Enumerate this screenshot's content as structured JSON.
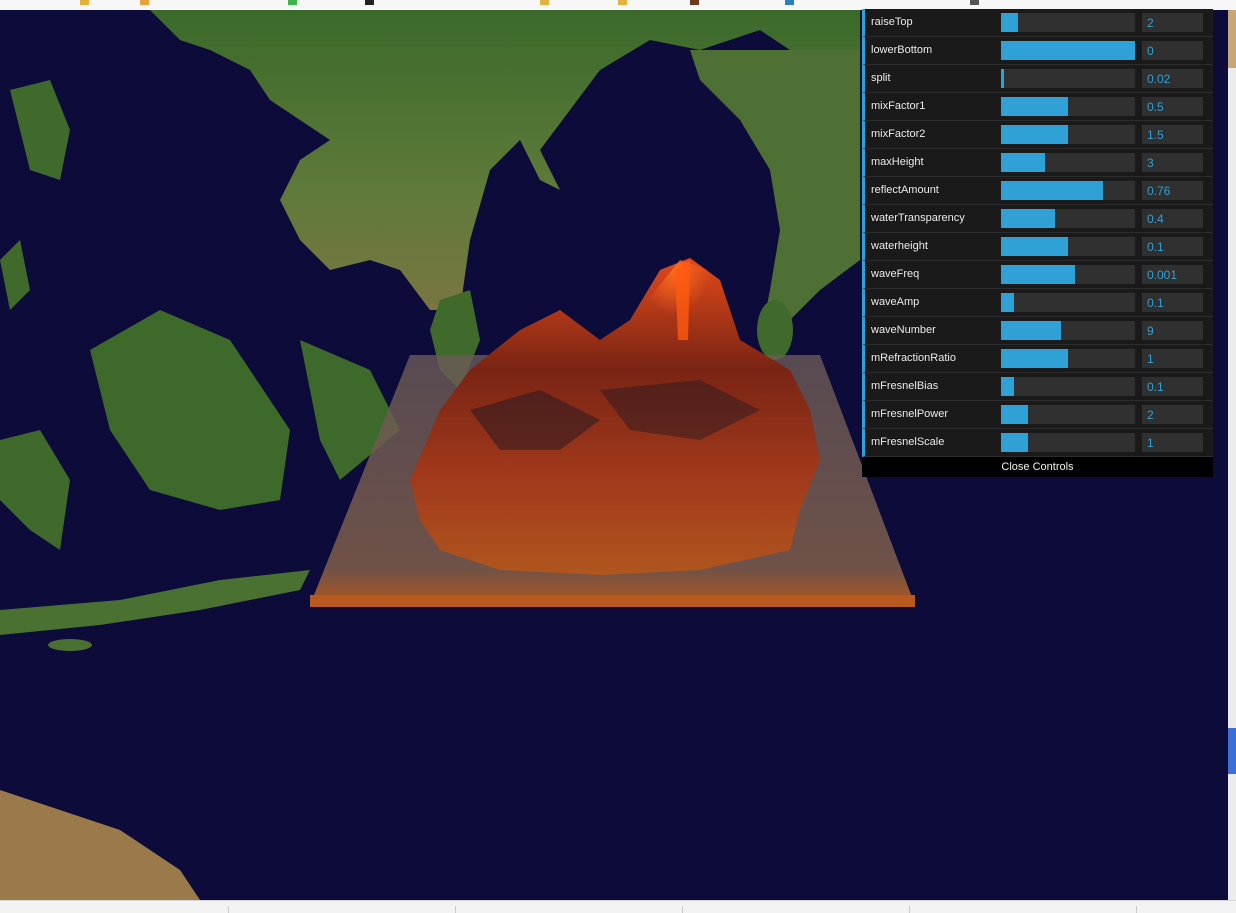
{
  "gui": {
    "controls": [
      {
        "label": "raiseTop",
        "value": "2",
        "fill": 0.13
      },
      {
        "label": "lowerBottom",
        "value": "0",
        "fill": 1.0
      },
      {
        "label": "split",
        "value": "0.02",
        "fill": 0.02
      },
      {
        "label": "mixFactor1",
        "value": "0.5",
        "fill": 0.5
      },
      {
        "label": "mixFactor2",
        "value": "1.5",
        "fill": 0.5
      },
      {
        "label": "maxHeight",
        "value": "3",
        "fill": 0.33
      },
      {
        "label": "reflectAmount",
        "value": "0.76",
        "fill": 0.76
      },
      {
        "label": "waterTransparency",
        "value": "0.4",
        "fill": 0.4
      },
      {
        "label": "waterheight",
        "value": "0.1",
        "fill": 0.5
      },
      {
        "label": "waveFreq",
        "value": "0.001",
        "fill": 0.55
      },
      {
        "label": "waveAmp",
        "value": "0.1",
        "fill": 0.1
      },
      {
        "label": "waveNumber",
        "value": "9",
        "fill": 0.45
      },
      {
        "label": "mRefractionRatio",
        "value": "1",
        "fill": 0.5
      },
      {
        "label": "mFresnelBias",
        "value": "0.1",
        "fill": 0.1
      },
      {
        "label": "mFresnelPower",
        "value": "2",
        "fill": 0.2
      },
      {
        "label": "mFresnelScale",
        "value": "1",
        "fill": 0.2
      }
    ],
    "close_label": "Close Controls",
    "accent": "#2fa1d6"
  },
  "scene": {
    "ocean_color": "#0c0b39",
    "land_color": "#3f6a2c",
    "lava_color": "#c2361a"
  }
}
